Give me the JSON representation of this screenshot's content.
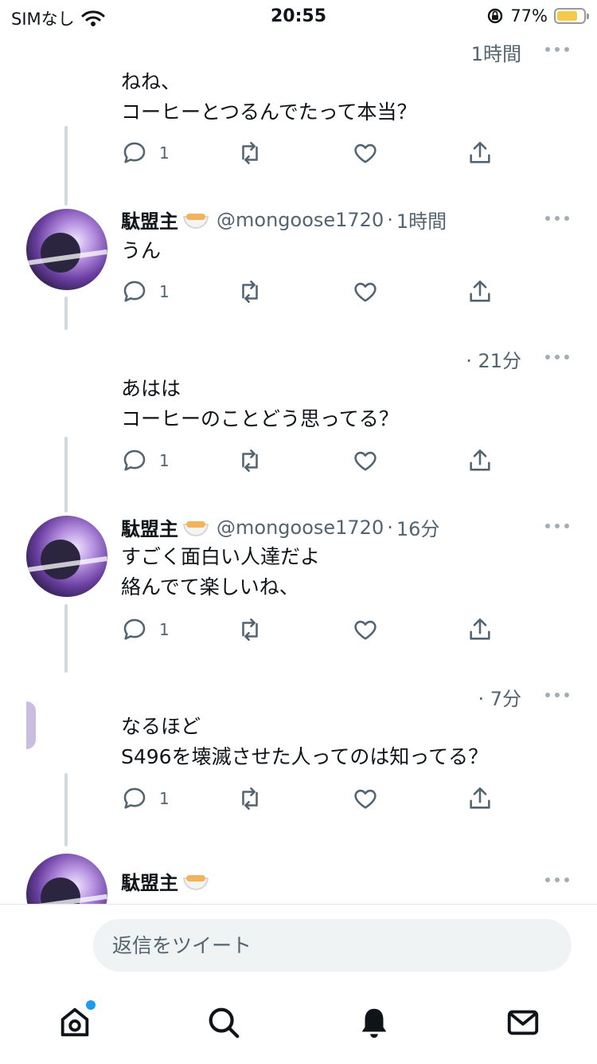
{
  "status_bar": {
    "carrier": "SIMなし",
    "time": "20:55",
    "battery_percent": "77%",
    "battery_level": 0.77
  },
  "tweets": [
    {
      "time": "1時間",
      "lines": [
        "ねね、",
        "コーヒーとつるんでたって本当？"
      ],
      "reply_count": "1"
    },
    {
      "display_name": "駄盟主",
      "handle": "@mongoose1720",
      "separator": "·",
      "time": "1時間",
      "lines": [
        "うん"
      ],
      "reply_count": "1"
    },
    {
      "time": "· 21分",
      "lines": [
        "あはは",
        "コーヒーのことどう思ってる？"
      ],
      "reply_count": "1"
    },
    {
      "display_name": "駄盟主",
      "handle": "@mongoose1720",
      "separator": "·",
      "time": "16分",
      "lines": [
        "すごく面白い人達だよ",
        "絡んでて楽しいね、"
      ],
      "reply_count": "1"
    },
    {
      "time": "· 7分",
      "lines": [
        "なるほど",
        "S496を壊滅させた人ってのは知ってる？"
      ],
      "reply_count": "1"
    },
    {
      "display_name": "駄盟主"
    }
  ],
  "reply_box": {
    "placeholder": "返信をツイート"
  },
  "tabs": [
    {
      "name": "home",
      "icon": "home-icon",
      "has_notification_dot": true
    },
    {
      "name": "search",
      "icon": "search-icon"
    },
    {
      "name": "notifications",
      "icon": "bell-icon"
    },
    {
      "name": "messages",
      "icon": "mail-icon"
    }
  ],
  "colors": {
    "accent": "#1d9bf0",
    "secondary_text": "#536471",
    "battery": "#f7c948"
  }
}
